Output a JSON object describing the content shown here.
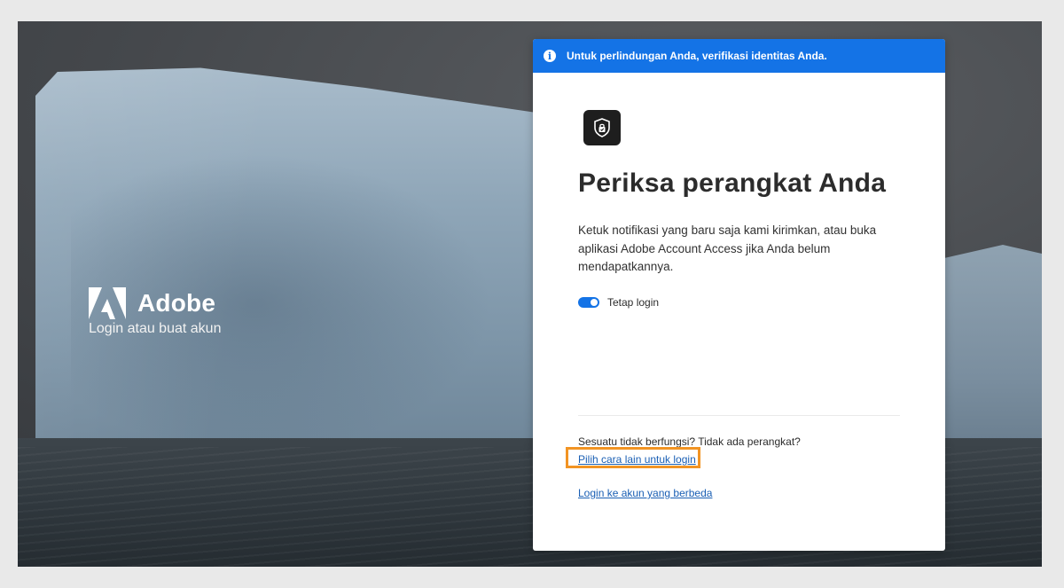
{
  "brand": {
    "name": "Adobe",
    "tagline": "Login atau buat akun"
  },
  "banner": {
    "message": "Untuk perlindungan Anda, verifikasi identitas Anda."
  },
  "card": {
    "heading": "Periksa perangkat Anda",
    "description": "Ketuk notifikasi yang baru saja kami kirimkan, atau buka aplikasi Adobe Account Access jika Anda belum mendapatkannya.",
    "stay_logged_in": {
      "label": "Tetap login",
      "checked": true
    },
    "help_question": "Sesuatu tidak berfungsi? Tidak ada perangkat?",
    "alt_method_link": "Pilih cara lain untuk login",
    "different_account_link": "Login ke akun yang berbeda"
  },
  "colors": {
    "accent": "#1473e6",
    "highlight": "#f29423",
    "link": "#1a5fb4"
  },
  "icons": {
    "banner": "info-icon",
    "app": "shield-lock-icon",
    "brand": "adobe-logo-icon"
  }
}
